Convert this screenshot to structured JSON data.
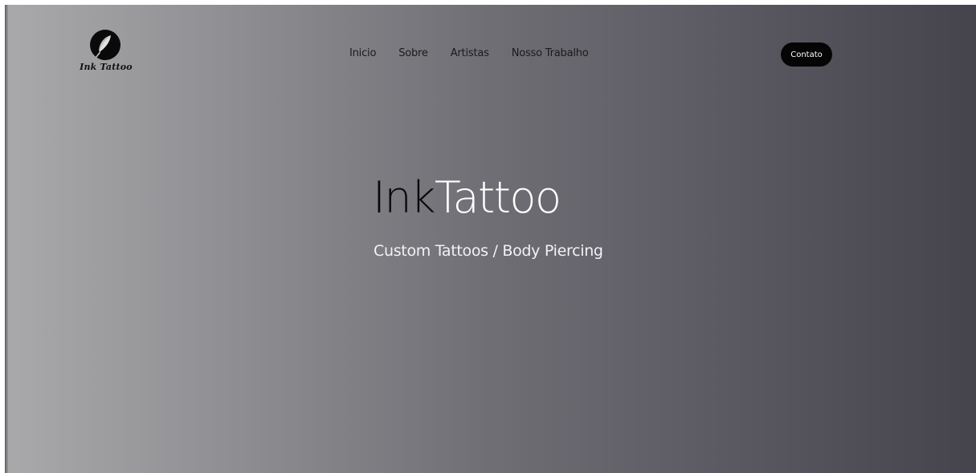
{
  "brand": {
    "logo_text": "Ink Tattoo",
    "logo_icon": "feather-quill-icon"
  },
  "nav": {
    "items": [
      {
        "label": "Inicio"
      },
      {
        "label": "Sobre"
      },
      {
        "label": "Artistas"
      },
      {
        "label": "Nosso Trabalho"
      }
    ]
  },
  "header": {
    "cta_label": "Contato"
  },
  "hero": {
    "title_part1": "Ink",
    "title_part2": "Tattoo",
    "subtitle": "Custom Tattoos / Body Piercing"
  },
  "colors": {
    "gradient_left": "#a9a9ab",
    "gradient_right": "#45444d",
    "button_bg": "#050505",
    "title_dark": "#0b0b0b",
    "title_light": "#ffffff"
  }
}
